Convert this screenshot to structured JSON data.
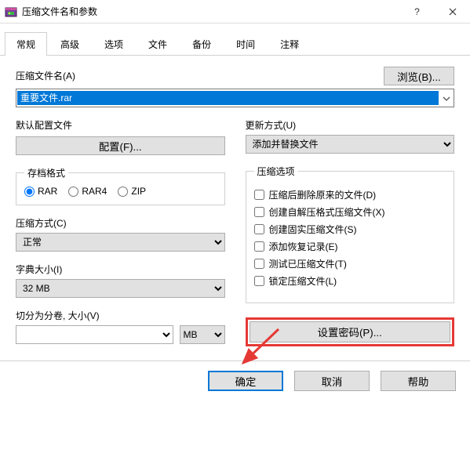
{
  "window": {
    "title": "压缩文件名和参数"
  },
  "tabs": [
    "常规",
    "高级",
    "选项",
    "文件",
    "备份",
    "时间",
    "注释"
  ],
  "labels": {
    "filename": "压缩文件名(A)",
    "browse": "浏览(B)...",
    "profile": "默认配置文件",
    "profile_btn": "配置(F)...",
    "update": "更新方式(U)",
    "archive_format": "存档格式",
    "comp_method": "压缩方式(C)",
    "dict_size": "字典大小(I)",
    "split": "切分为分卷, 大小(V)",
    "comp_opts": "压缩选项",
    "set_pwd": "设置密码(P)..."
  },
  "values": {
    "filename": "重要文件.rar",
    "update_mode": "添加并替换文件",
    "comp_method": "正常",
    "dict_size": "32 MB",
    "split_size": "",
    "split_unit": "MB"
  },
  "formats": {
    "rar": "RAR",
    "rar4": "RAR4",
    "zip": "ZIP"
  },
  "options": {
    "del_after": "压缩后删除原来的文件(D)",
    "sfx": "创建自解压格式压缩文件(X)",
    "solid": "创建固实压缩文件(S)",
    "recovery": "添加恢复记录(E)",
    "test": "测试已压缩文件(T)",
    "lock": "锁定压缩文件(L)"
  },
  "buttons": {
    "ok": "确定",
    "cancel": "取消",
    "help": "帮助"
  }
}
